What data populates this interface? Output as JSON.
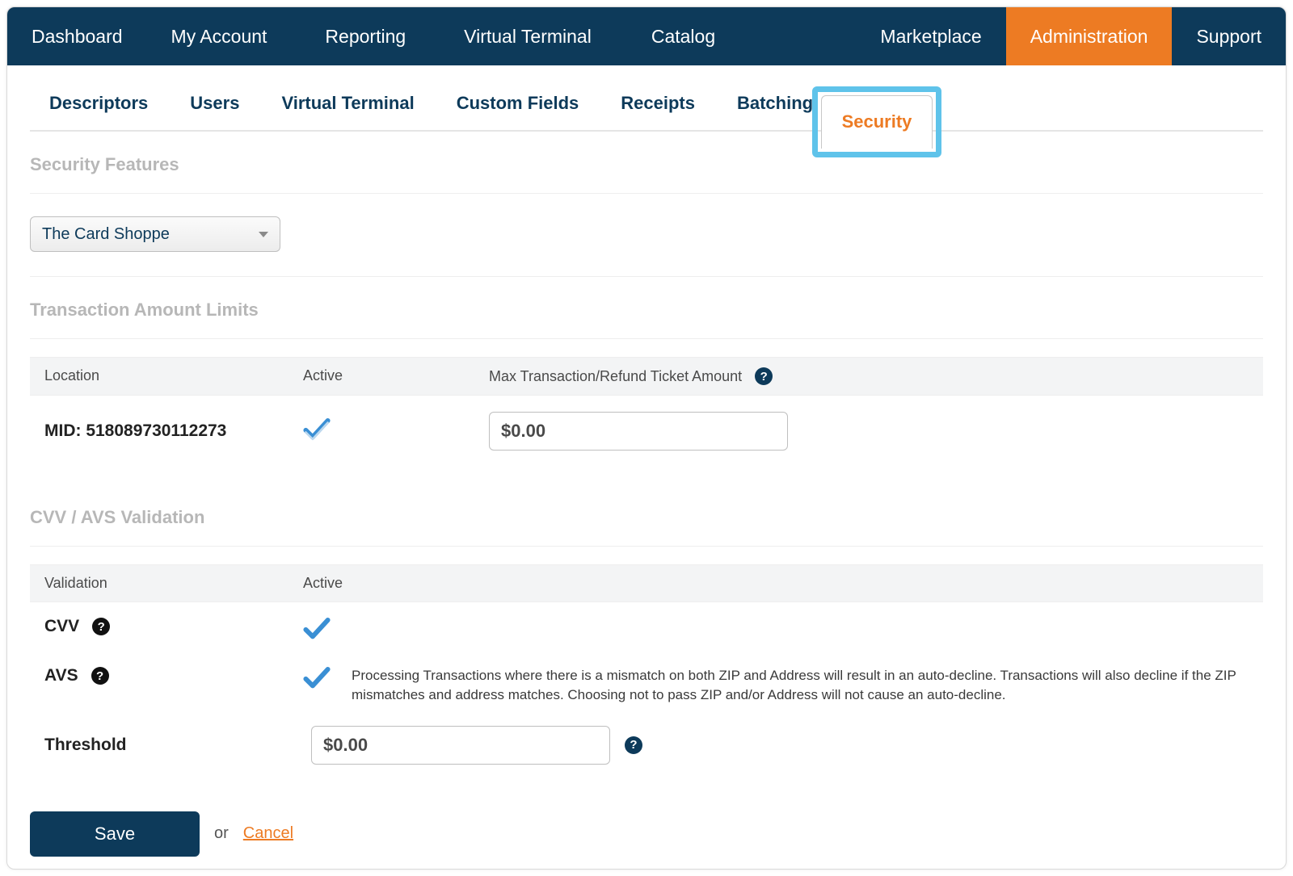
{
  "topnav": {
    "items": [
      "Dashboard",
      "My Account",
      "Reporting",
      "Virtual Terminal",
      "Catalog",
      "Marketplace",
      "Administration",
      "Support"
    ],
    "active_index": 6
  },
  "subtabs": {
    "items": [
      "Descriptors",
      "Users",
      "Virtual Terminal",
      "Custom Fields",
      "Receipts",
      "Batching",
      "Security"
    ],
    "active_index": 6
  },
  "sections": {
    "security_features": "Security Features",
    "transaction_limits": "Transaction Amount Limits",
    "cvv_avs": "CVV / AVS Validation"
  },
  "merchant_select": {
    "selected": "The Card Shoppe"
  },
  "limits_table": {
    "headers": {
      "location": "Location",
      "active": "Active",
      "max": "Max Transaction/Refund Ticket Amount"
    },
    "row": {
      "location": "MID: 518089730112273",
      "active": true,
      "amount": "$0.00"
    }
  },
  "validation_table": {
    "headers": {
      "validation": "Validation",
      "active": "Active"
    },
    "cvv": {
      "label": "CVV",
      "active": true
    },
    "avs": {
      "label": "AVS",
      "active": true,
      "note": "Processing Transactions where there is a mismatch on both ZIP and Address will result in an auto-decline. Transactions will also decline if the ZIP mismatches and address matches. Choosing not to pass ZIP and/or Address will not cause an auto-decline."
    },
    "threshold": {
      "label": "Threshold",
      "amount": "$0.00"
    }
  },
  "footer": {
    "save": "Save",
    "or": "or",
    "cancel": "Cancel"
  }
}
